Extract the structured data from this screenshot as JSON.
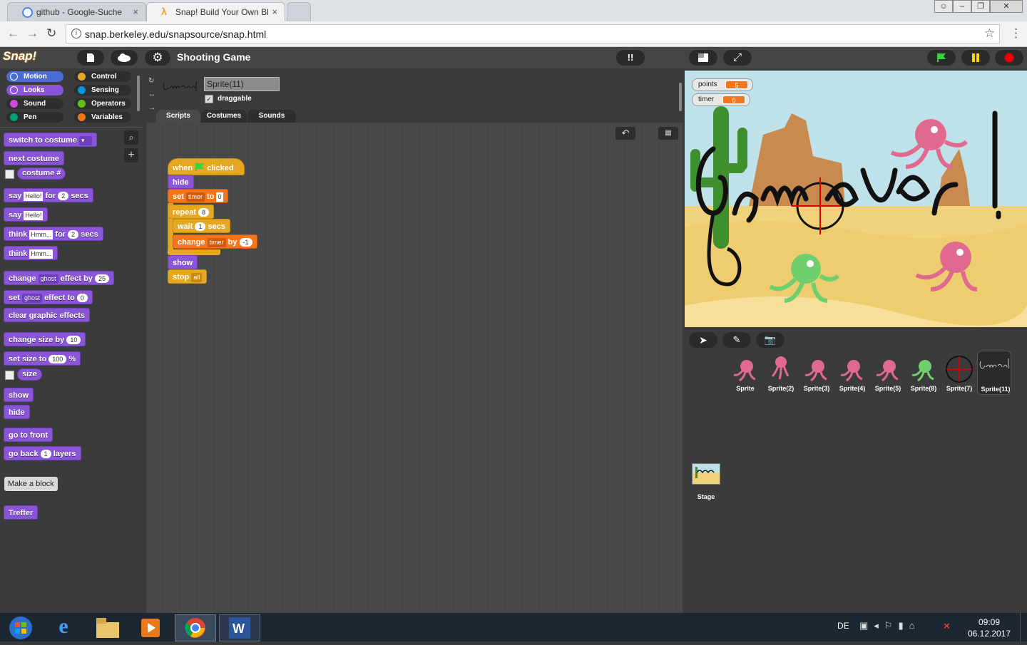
{
  "browser": {
    "tabs": [
      {
        "label": "github - Google-Suche",
        "close": "×"
      },
      {
        "label": "Snap! Build Your Own Bl",
        "close": "×"
      }
    ],
    "url": "snap.berkeley.edu/snapsource/snap.html",
    "info": "i",
    "star": "☆",
    "menu": "⋮",
    "back": "←",
    "forward": "→",
    "reload": "↻"
  },
  "snap": {
    "logo": "Snap!",
    "project_title": "Shooting Game",
    "categories": [
      {
        "label": "Motion",
        "color": "#4a6cd4"
      },
      {
        "label": "Control",
        "color": "#e6a822"
      },
      {
        "label": "Looks",
        "color": "#8a55d7"
      },
      {
        "label": "Sensing",
        "color": "#0494dc"
      },
      {
        "label": "Sound",
        "color": "#cf4ad9"
      },
      {
        "label": "Operators",
        "color": "#62c213"
      },
      {
        "label": "Pen",
        "color": "#00a178"
      },
      {
        "label": "Variables",
        "color": "#f3761d"
      }
    ],
    "palette": {
      "switch_costume": "switch to costume",
      "next_costume": "next costume",
      "costume_num": "costume #",
      "say": "say",
      "hello": "Hello!",
      "for": "for",
      "secs": "secs",
      "two": "2",
      "think": "think",
      "hmm": "Hmm...",
      "change": "change",
      "ghost": "ghost",
      "effect_by": "effect by",
      "twentyfive": "25",
      "set": "set",
      "effect_to": "effect to",
      "zero": "0",
      "clear": "clear graphic effects",
      "change_size_by": "change size by",
      "ten": "10",
      "set_size_to": "set size to",
      "hundred": "100",
      "percent": "%",
      "size": "size",
      "show": "show",
      "hide": "hide",
      "go_front": "go to front",
      "go_back": "go back",
      "one": "1",
      "layers": "layers",
      "make_block": "Make a block",
      "treffer": "Treffer"
    },
    "sprite": {
      "name": "Sprite(11)",
      "draggable_label": "draggable",
      "tabs": [
        "Scripts",
        "Costumes",
        "Sounds"
      ]
    },
    "script": {
      "when": "when",
      "clicked": "clicked",
      "hide": "hide",
      "set": "set",
      "timer": "timer",
      "to": "to",
      "set_value": "0",
      "repeat": "repeat",
      "repeat_count": "8",
      "wait": "wait",
      "wait_value": "1",
      "secs": "secs",
      "change": "change",
      "by": "by",
      "change_value": "-1",
      "show": "show",
      "stop": "stop",
      "all": "all"
    },
    "watchers": [
      {
        "label": "points",
        "value": "5"
      },
      {
        "label": "timer",
        "value": "0"
      }
    ],
    "corral": {
      "sprites": [
        "Sprite",
        "Sprite(2)",
        "Sprite(3)",
        "Sprite(4)",
        "Sprite(5)",
        "Sprite(8)",
        "Sprite(7)",
        "Sprite(11)"
      ],
      "stage_label": "Stage"
    }
  },
  "taskbar": {
    "lang": "DE",
    "time": "09:09",
    "date": "06.12.2017"
  }
}
